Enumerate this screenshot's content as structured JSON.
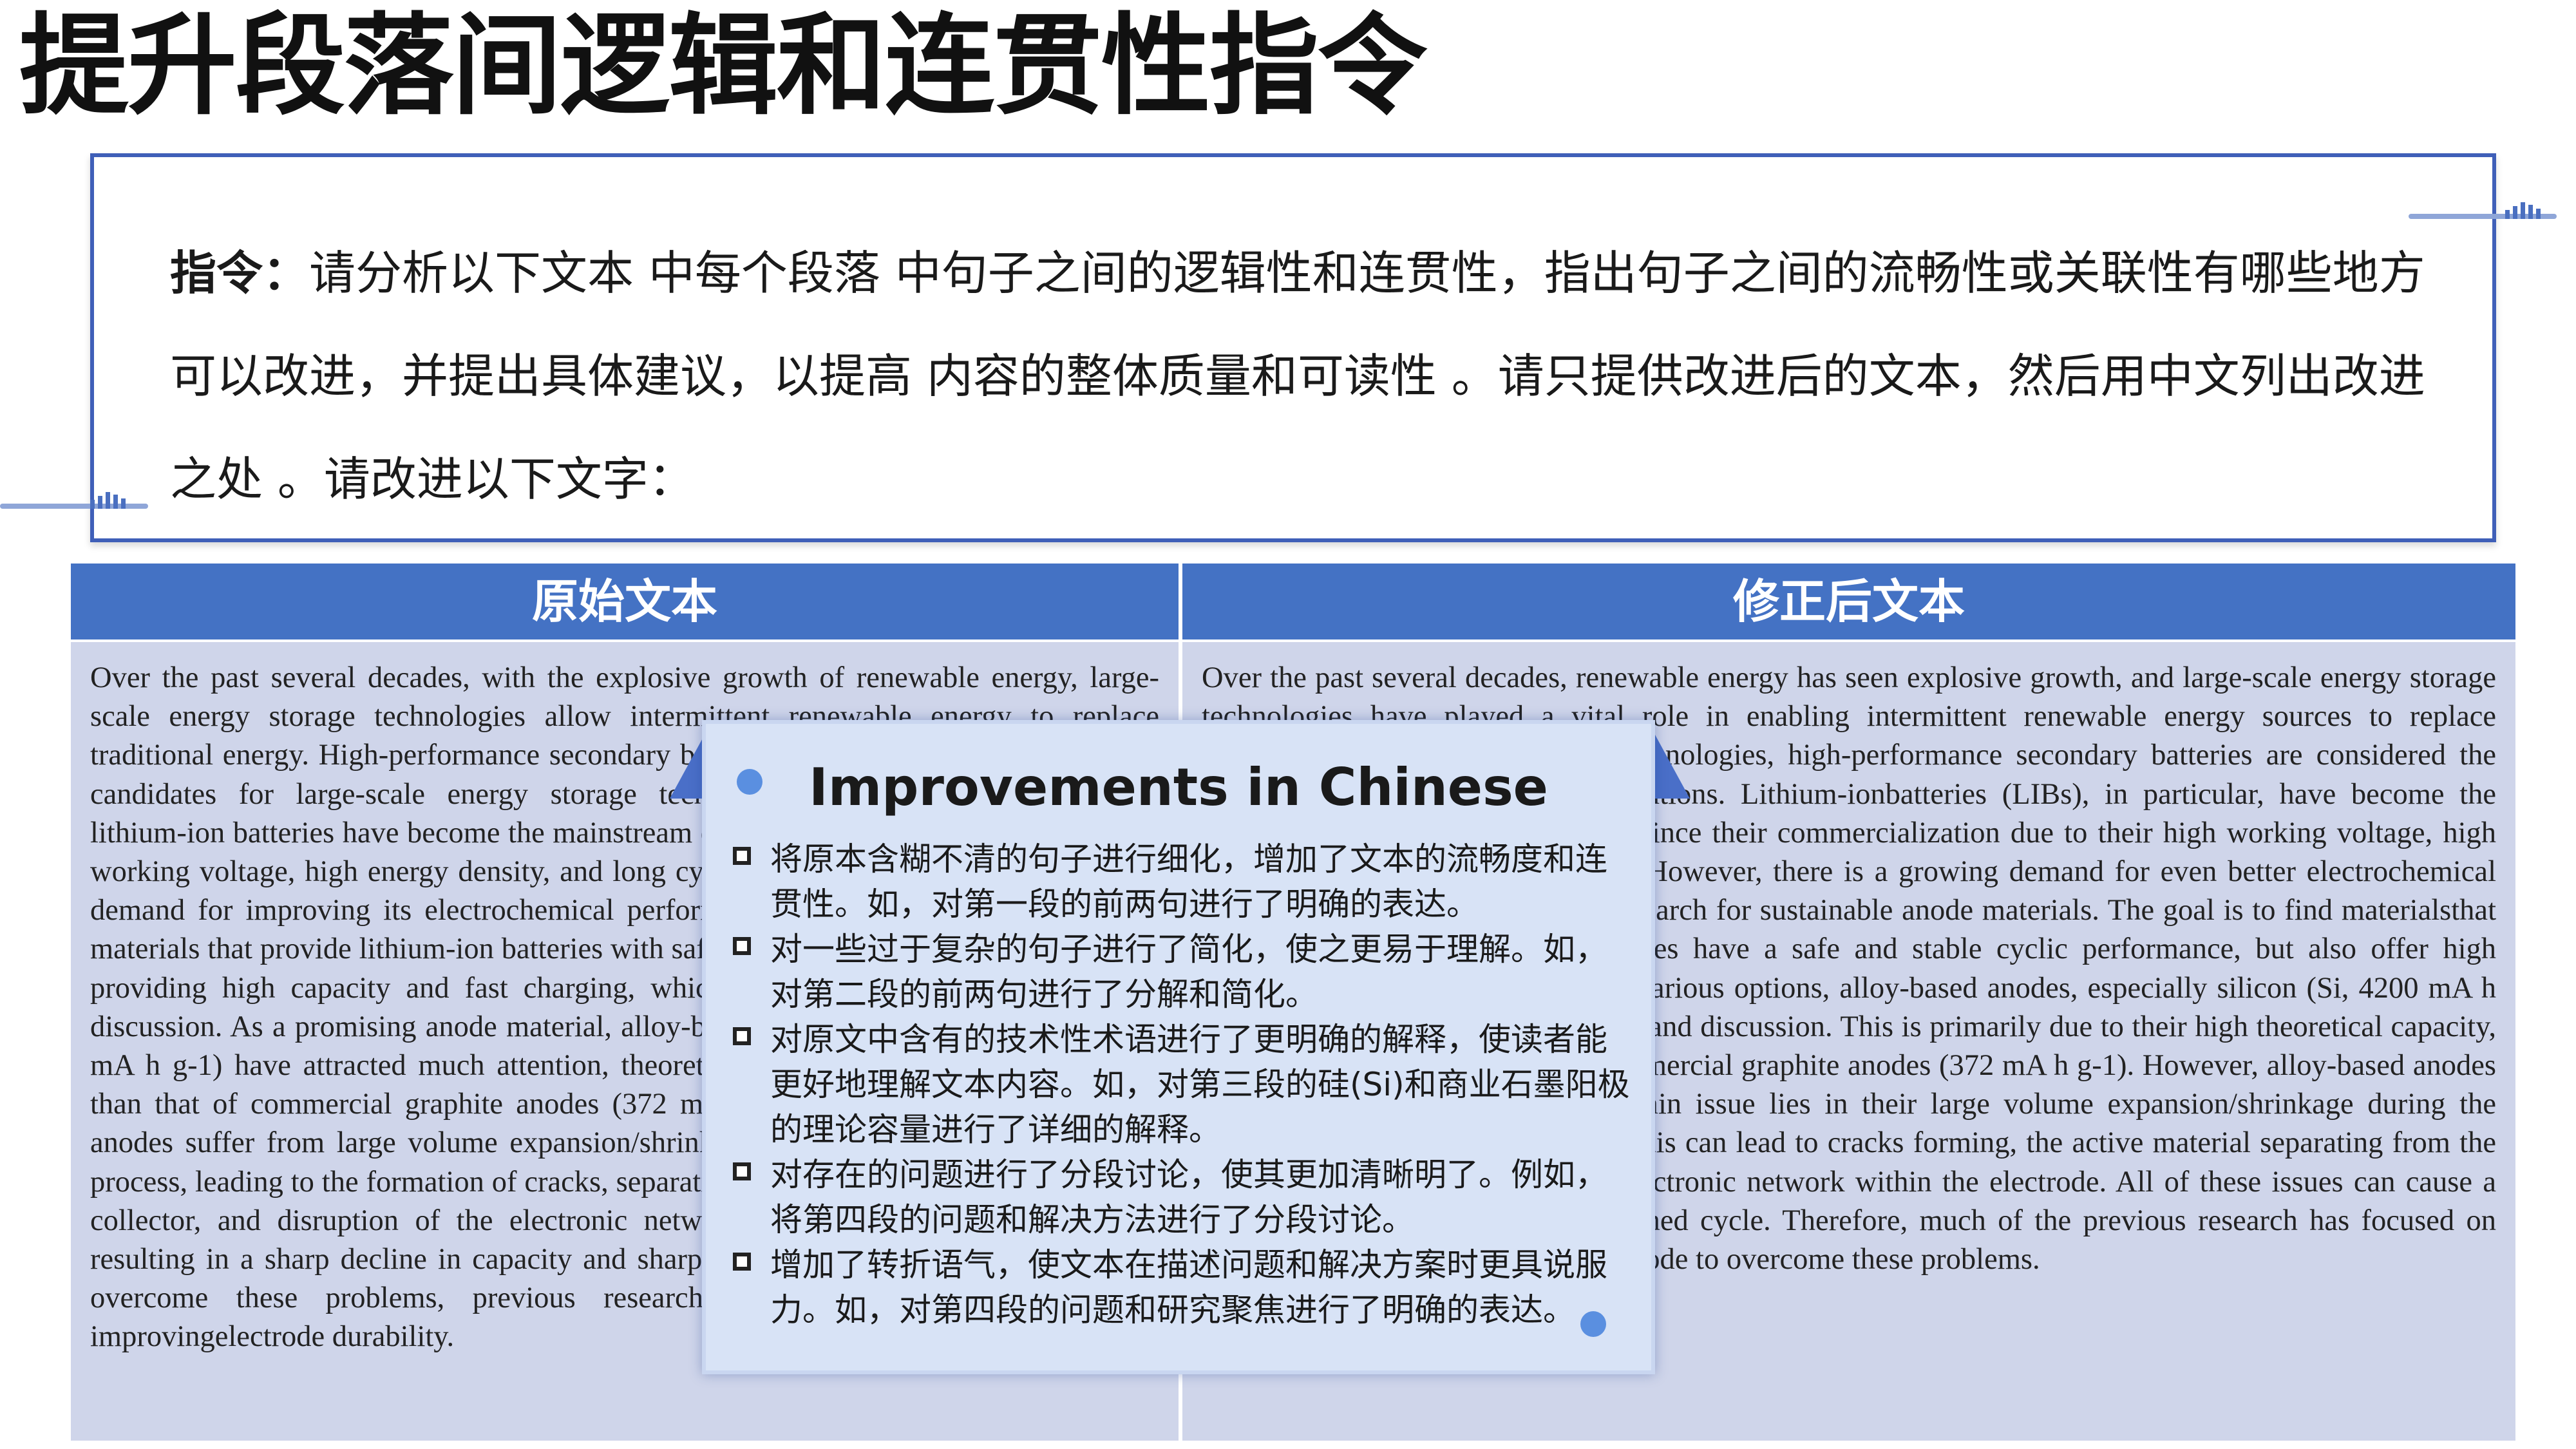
{
  "page": {
    "title": "提升段落间逻辑和连贯性指令"
  },
  "instruction": {
    "label": "指令：",
    "text": "请分析以下文本 中每个段落 中句子之间的逻辑性和连贯性，指出句子之间的流畅性或关联性有哪些地方可以改进，并提出具体建议，以提高 内容的整体质量和可读性 。请只提供改进后的文本，然后用中文列出改进之处 。请改进以下文字："
  },
  "table": {
    "headers": [
      "原始文本",
      "修正后文本"
    ],
    "original_text": "Over the past several decades, with the explosive growth of renewable energy, large-scale energy storage technologies allow intermittent renewable energy to replace traditional energy. High-performance secondary batteries are one of the most promising candidates for large-scale energy storage technologies. Since commercialization, lithium-ion batteries have become the mainstream energy storage devices with their high working voltage, high energy density, and long cycle life. In order to meet the growing demand for improving its electrochemical performance, it is necessary to find anode materials that provide lithium-ion batteries with safe and stable cycle performance, while providing high capacity and fast charging, which has led to in-depth research and discussion. As a promising anode material, alloy-based anodes such as silicon (Si, 4200 mA h g-1) have attracted much attention, theoretical capacity, nearly 10 times higher than that of commercial graphite anodes (372 mA h g-1). Unfortunately, alloy-based anodes suffer from large volume expansion/shrinkage during the lithiation/delithiation process, leading to the formation of cracks, separation of active material from the current collector, and disruption of the electronic network within the electrode, ultimately resulting in a sharp decline in capacity and sharp attenuation of cycle life. In order to overcome these problems, previous research has put a lot of effort into improvingelectrode durability.",
    "revised_text": "Over the past several decades, renewable energy has seen explosive growth, and large-scale energy storage technologies have played a vital role in enabling intermittent renewable energy sources to replace traditional energy. Among these technologies, high-performance secondary batteries are considered the most promising energy storage solutions. Lithium-ionbatteries (LIBs), in particular, have become the mainstream energy storage devices since their commercialization due to their high working voltage, high energy density, and long cycle life. However, there is a growing demand for even better electrochemical performance, which has driven the search for sustainable anode materials. The goal is to find materialsthat not only provide lithium-ion batteries have a safe and stable cyclic performance, but also offer high capacity and fast charging. Among various options, alloy-based anodes, especially silicon (Si, 4200 mA h g-1), have sparked in-depth research and discussion. This is primarily due to their high theoretical capacity, which is nearly 10 times that of commercial graphite anodes (372 mA h g-1). However, alloy-based anodes have significant drawbacks. The main issue lies in their large volume expansion/shrinkage during the lithiation and delithiation process. This can lead to cracks forming, the active material separating from the current collector, and a disrupted electronic network within the electrode. All of these issues can cause a sharp drop in capacity and a shortened cycle. Therefore, much of the previous research has focused on improving the durability of the electrode to overcome these problems."
  },
  "popup": {
    "title": "Improvements in Chinese",
    "items": [
      "将原本含糊不清的句子进行细化，增加了文本的流畅度和连贯性。如，对第一段的前两句进行了明确的表达。",
      "对一些过于复杂的句子进行了简化，使之更易于理解。如，对第二段的前两句进行了分解和简化。",
      "对原文中含有的技术性术语进行了更明确的解释，使读者能更好地理解文本内容。如，对第三段的硅(Si)和商业石墨阳极的理论容量进行了详细的解释。",
      "对存在的问题进行了分段讨论，使其更加清晰明了。例如，将第四段的问题和解决方法进行了分段讨论。",
      "增加了转折语气，使文本在描述问题和解决方案时更具说服力。如，对第四段的问题和研究聚焦进行了明确的表达。"
    ]
  },
  "colors": {
    "header_blue": "#4472c4",
    "cell_bg": "#cfd5ea",
    "border_blue": "#3f5fb8",
    "popup_bg": "#d8e3f6"
  }
}
